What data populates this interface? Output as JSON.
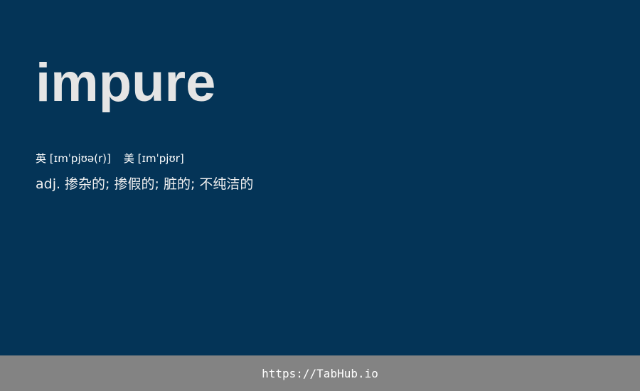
{
  "entry": {
    "word": "impure",
    "phonetic_uk": "英 [ɪmˈpjʊə(r)]",
    "phonetic_us": "美 [ɪmˈpjʊr]",
    "definition": "adj. 掺杂的;  掺假的; 脏的; 不纯洁的"
  },
  "footer": {
    "link_text": "https://TabHub.io"
  },
  "colors": {
    "background": "#043457",
    "footer_background": "#838383",
    "text": "#e6e6e6"
  }
}
